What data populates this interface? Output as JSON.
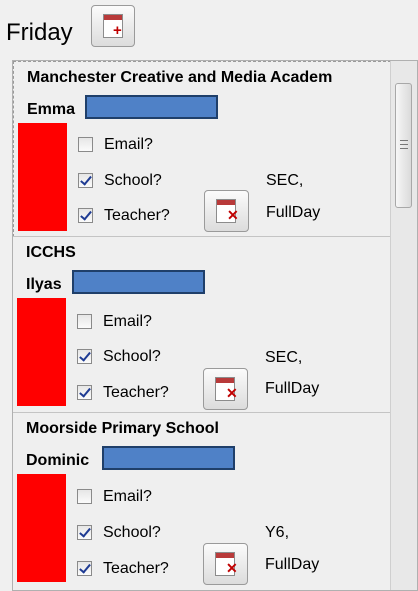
{
  "day": "Friday",
  "options": {
    "email": "Email?",
    "school": "School?",
    "teacher": "Teacher?"
  },
  "entries": [
    {
      "school": "Manchester Creative and Media Academ",
      "pupil": "Emma",
      "email": false,
      "school_checked": true,
      "teacher": true,
      "info1": "SEC,",
      "info2": "FullDay"
    },
    {
      "school": "ICCHS",
      "pupil": "Ilyas",
      "email": false,
      "school_checked": true,
      "teacher": true,
      "info1": "SEC,",
      "info2": "FullDay"
    },
    {
      "school": "Moorside Primary School",
      "pupil": "Dominic",
      "email": false,
      "school_checked": true,
      "teacher": true,
      "info1": "Y6,",
      "info2": "FullDay"
    }
  ],
  "colors": {
    "redact_blue": "#4f81c7",
    "block_red": "#ff0000"
  },
  "icons": {
    "add": "calendar-add-icon",
    "remove": "calendar-remove-icon"
  }
}
